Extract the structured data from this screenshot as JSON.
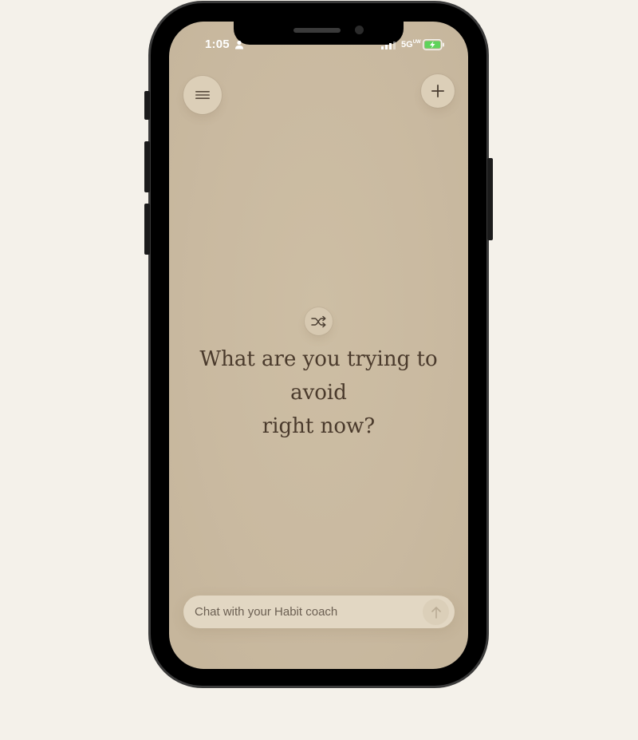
{
  "status_bar": {
    "time": "1:05",
    "network": "5G",
    "network_suffix": "UW"
  },
  "header": {
    "menu_icon": "menu-icon",
    "add_icon": "plus-icon"
  },
  "main": {
    "shuffle_icon": "shuffle-icon",
    "prompt_line1": "What are you trying to avoid",
    "prompt_line2": "right now?"
  },
  "chat": {
    "placeholder": "Chat with your Habit coach",
    "send_icon": "arrow-up-icon"
  },
  "colors": {
    "page_background": "#f4f1ea",
    "screen_background": "#c9b9a0",
    "button_background": "#dccfb8",
    "prompt_text": "#4a3a2c",
    "battery_green": "#5fd35a"
  }
}
